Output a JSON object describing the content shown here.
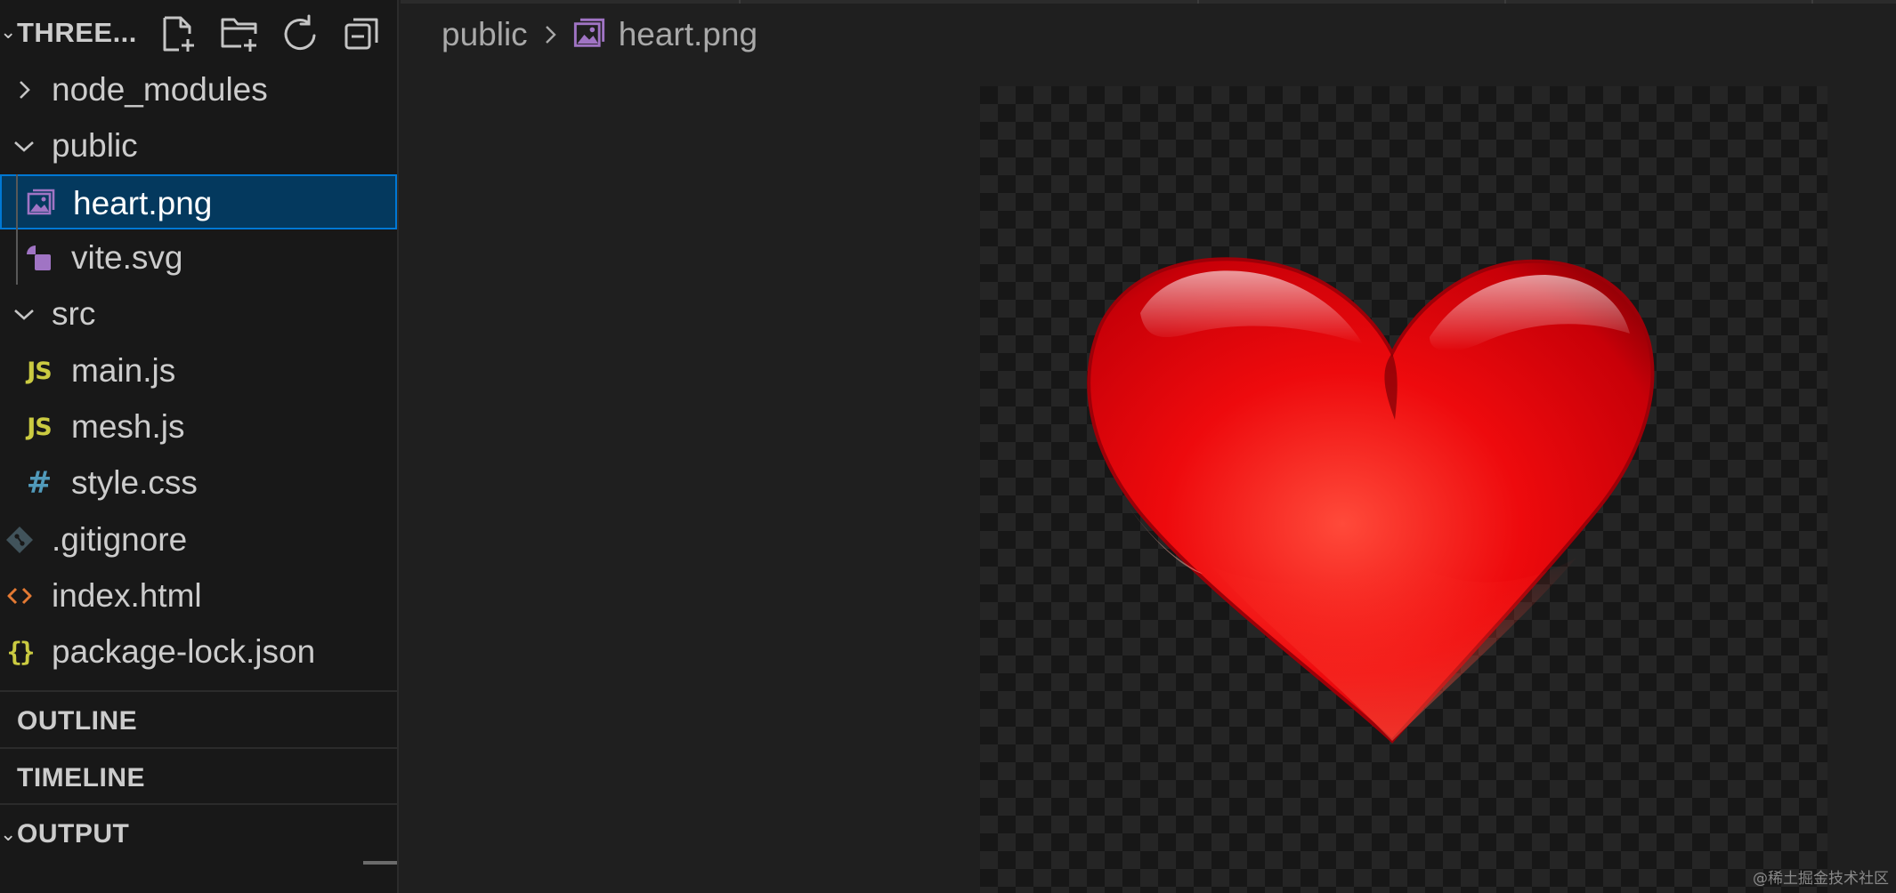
{
  "explorer": {
    "title": "THREE...",
    "actions": [
      {
        "name": "new-file-icon"
      },
      {
        "name": "new-folder-icon"
      },
      {
        "name": "refresh-icon"
      },
      {
        "name": "collapse-all-icon"
      }
    ]
  },
  "tree": {
    "node_modules": "node_modules",
    "public": "public",
    "heart_png": "heart.png",
    "vite_svg": "vite.svg",
    "src": "src",
    "main_js": "main.js",
    "mesh_js": "mesh.js",
    "style_css": "style.css",
    "gitignore": ".gitignore",
    "index_html": "index.html",
    "package_lock": "package-lock.json",
    "js_badge": "JS",
    "css_badge": "#",
    "json_badge": "{}"
  },
  "panels": {
    "outline": "OUTLINE",
    "timeline": "TIMELINE",
    "output": "OUTPUT"
  },
  "breadcrumb": {
    "folder": "public",
    "file": "heart.png"
  },
  "colors": {
    "selection_bg": "#04395e",
    "selection_border": "#0078d4",
    "image_icon": "#a074c4",
    "js": "#cbcb41",
    "css": "#519aba",
    "html": "#e37933",
    "git": "#41535b",
    "heart": "#e8060f"
  },
  "watermark": "@稀土掘金技术社区"
}
